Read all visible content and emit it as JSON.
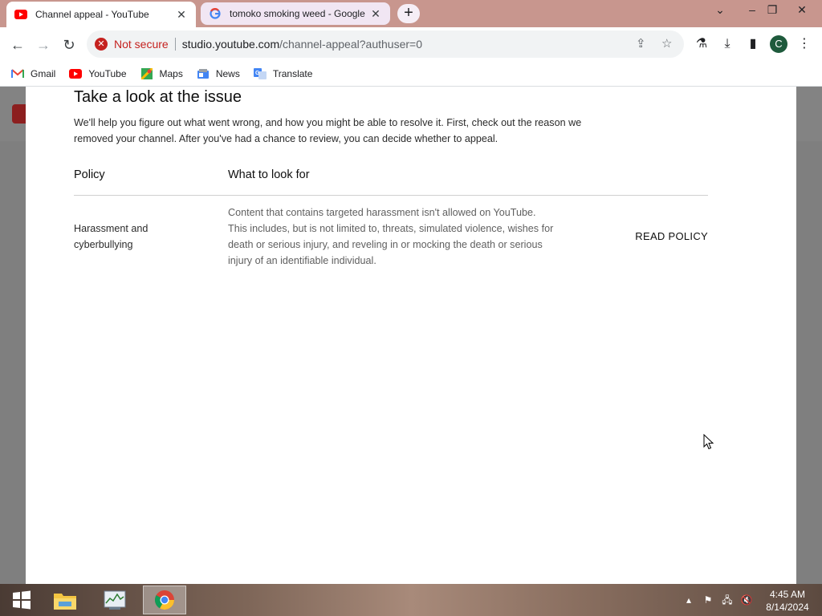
{
  "browser": {
    "tabs": [
      {
        "title": "Channel appeal - YouTube",
        "favicon": "youtube-icon",
        "active": true
      },
      {
        "title": "tomoko smoking weed - Google",
        "favicon": "google-icon",
        "active": false
      }
    ],
    "omnibox": {
      "security_label": "Not secure",
      "url_host": "studio.youtube.com",
      "url_path": "/channel-appeal?authuser=0"
    },
    "profile_initial": "C",
    "bookmarks": [
      {
        "label": "Gmail",
        "icon": "gmail-icon"
      },
      {
        "label": "YouTube",
        "icon": "youtube-icon"
      },
      {
        "label": "Maps",
        "icon": "maps-icon"
      },
      {
        "label": "News",
        "icon": "news-icon"
      },
      {
        "label": "Translate",
        "icon": "translate-icon"
      }
    ]
  },
  "dialog": {
    "heading": "Take a look at the issue",
    "intro": "We'll help you figure out what went wrong, and how you might be able to resolve it. First, check out the reason we removed your channel. After you've had a chance to review, you can decide whether to appeal.",
    "columns": {
      "policy": "Policy",
      "what": "What to look for"
    },
    "rows": [
      {
        "policy": "Harassment and cyberbullying",
        "description": "Content that contains targeted harassment isn't allowed on YouTube. This includes, but is not limited to, threats, simulated violence, wishes for death or serious injury, and reveling in or mocking the death or serious injury of an identifiable individual.",
        "action": "READ POLICY"
      }
    ]
  },
  "taskbar": {
    "time": "4:45 AM",
    "date": "8/14/2024",
    "apps": [
      "start-icon",
      "file-explorer-icon",
      "task-manager-icon",
      "chrome-icon"
    ]
  },
  "colors": {
    "not_secure": "#c5221f",
    "youtube_red": "#ff0000",
    "tab_strip": "#c8968e"
  }
}
